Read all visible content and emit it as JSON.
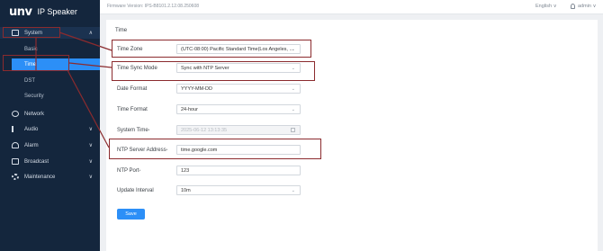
{
  "brand": {
    "logo": "unv",
    "product": "IP Speaker"
  },
  "topbar": {
    "firmware": "Firmware Version: IPS-B8101.2.12.08.250608",
    "language": "English ∨",
    "user": "admin ∨"
  },
  "sidebar": {
    "groups": [
      {
        "label": "System",
        "icon": "monitor-icon",
        "chevron": "∧"
      },
      {
        "label": "Network",
        "icon": "globe-icon",
        "chevron": ""
      },
      {
        "label": "Audio",
        "icon": "audio-icon",
        "chevron": "∨"
      },
      {
        "label": "Alarm",
        "icon": "bell-icon",
        "chevron": "∨"
      },
      {
        "label": "Broadcast",
        "icon": "broadcast-icon",
        "chevron": "∨"
      },
      {
        "label": "Maintenance",
        "icon": "gear-icon",
        "chevron": "∨"
      }
    ],
    "system_items": [
      "Basic",
      "Time",
      "DST",
      "Security"
    ]
  },
  "main": {
    "section_title": "Time",
    "fields": [
      {
        "label": "Time Zone",
        "value": "(UTC-08:00) Pacific Standard Time(Los Angeles, ...",
        "type": "select"
      },
      {
        "label": "Time Sync Mode",
        "value": "Sync with NTP Server",
        "type": "select"
      },
      {
        "label": "Date Format",
        "value": "YYYY-MM-DD",
        "type": "select"
      },
      {
        "label": "Time Format",
        "value": "24-hour",
        "type": "select"
      },
      {
        "label": "System Time",
        "value": "2025-06-12 13:13:35",
        "type": "date"
      },
      {
        "label": "NTP Server Address",
        "value": "time.google.com",
        "type": "input"
      },
      {
        "label": "NTP Port",
        "value": "123",
        "type": "input"
      },
      {
        "label": "Update Interval",
        "value": "10m",
        "type": "select"
      }
    ],
    "required_marks": {
      "system_time": "*",
      "ntp_server": "*",
      "ntp_port": "*"
    },
    "save_label": "Save"
  },
  "colors": {
    "sidebar_bg": "#14263d",
    "accent": "#2c8ff7",
    "annotation": "#8b2b2e"
  }
}
